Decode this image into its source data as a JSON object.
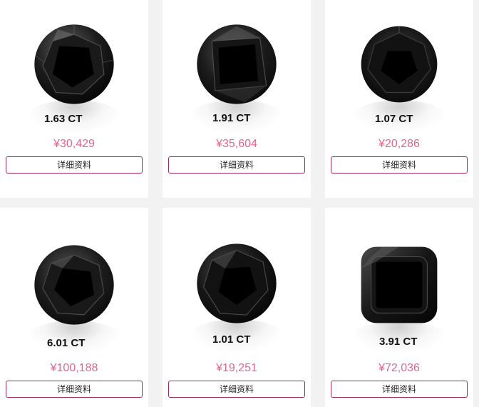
{
  "products": [
    {
      "carat": "1.63  CT",
      "price": "¥30,429",
      "button": "详细资料",
      "shape": "round"
    },
    {
      "carat": "1.91 CT",
      "price": "¥35,604",
      "button": "详细资料",
      "shape": "round"
    },
    {
      "carat": "1.07 CT",
      "price": "¥20,286",
      "button": "详细资料",
      "shape": "round"
    },
    {
      "carat": "6.01 CT",
      "price": "¥100,188",
      "button": "详细资料",
      "shape": "round"
    },
    {
      "carat": "1.01 CT",
      "price": "¥19,251",
      "button": "详细资料",
      "shape": "round"
    },
    {
      "carat": "3.91 CT",
      "price": "¥72,036",
      "button": "详细资料",
      "shape": "cushion"
    }
  ],
  "colors": {
    "price": "#e0678a",
    "button_border": "#9e2a5a",
    "background": "#f2f2f2"
  }
}
